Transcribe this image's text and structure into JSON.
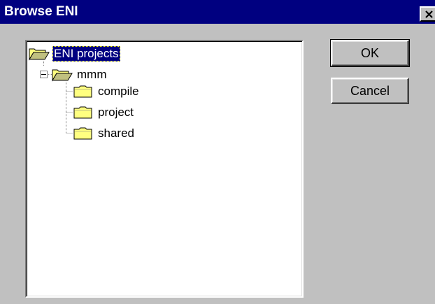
{
  "window": {
    "title": "Browse ENI",
    "close_glyph": "close-icon"
  },
  "tree": {
    "root": {
      "label": "ENI projects",
      "icon": "open-folder-icon",
      "selected": true
    },
    "child": {
      "label": "mmm",
      "icon": "open-folder-icon",
      "expanded": true
    },
    "grandchildren": [
      {
        "label": "compile",
        "icon": "folder-icon"
      },
      {
        "label": "project",
        "icon": "folder-icon"
      },
      {
        "label": "shared",
        "icon": "folder-icon"
      }
    ]
  },
  "buttons": {
    "ok_label": "OK",
    "cancel_label": "Cancel"
  },
  "colors": {
    "titlebar": "#000080",
    "face": "#c0c0c0",
    "selection": "#000080",
    "folder": "#ffff80"
  }
}
